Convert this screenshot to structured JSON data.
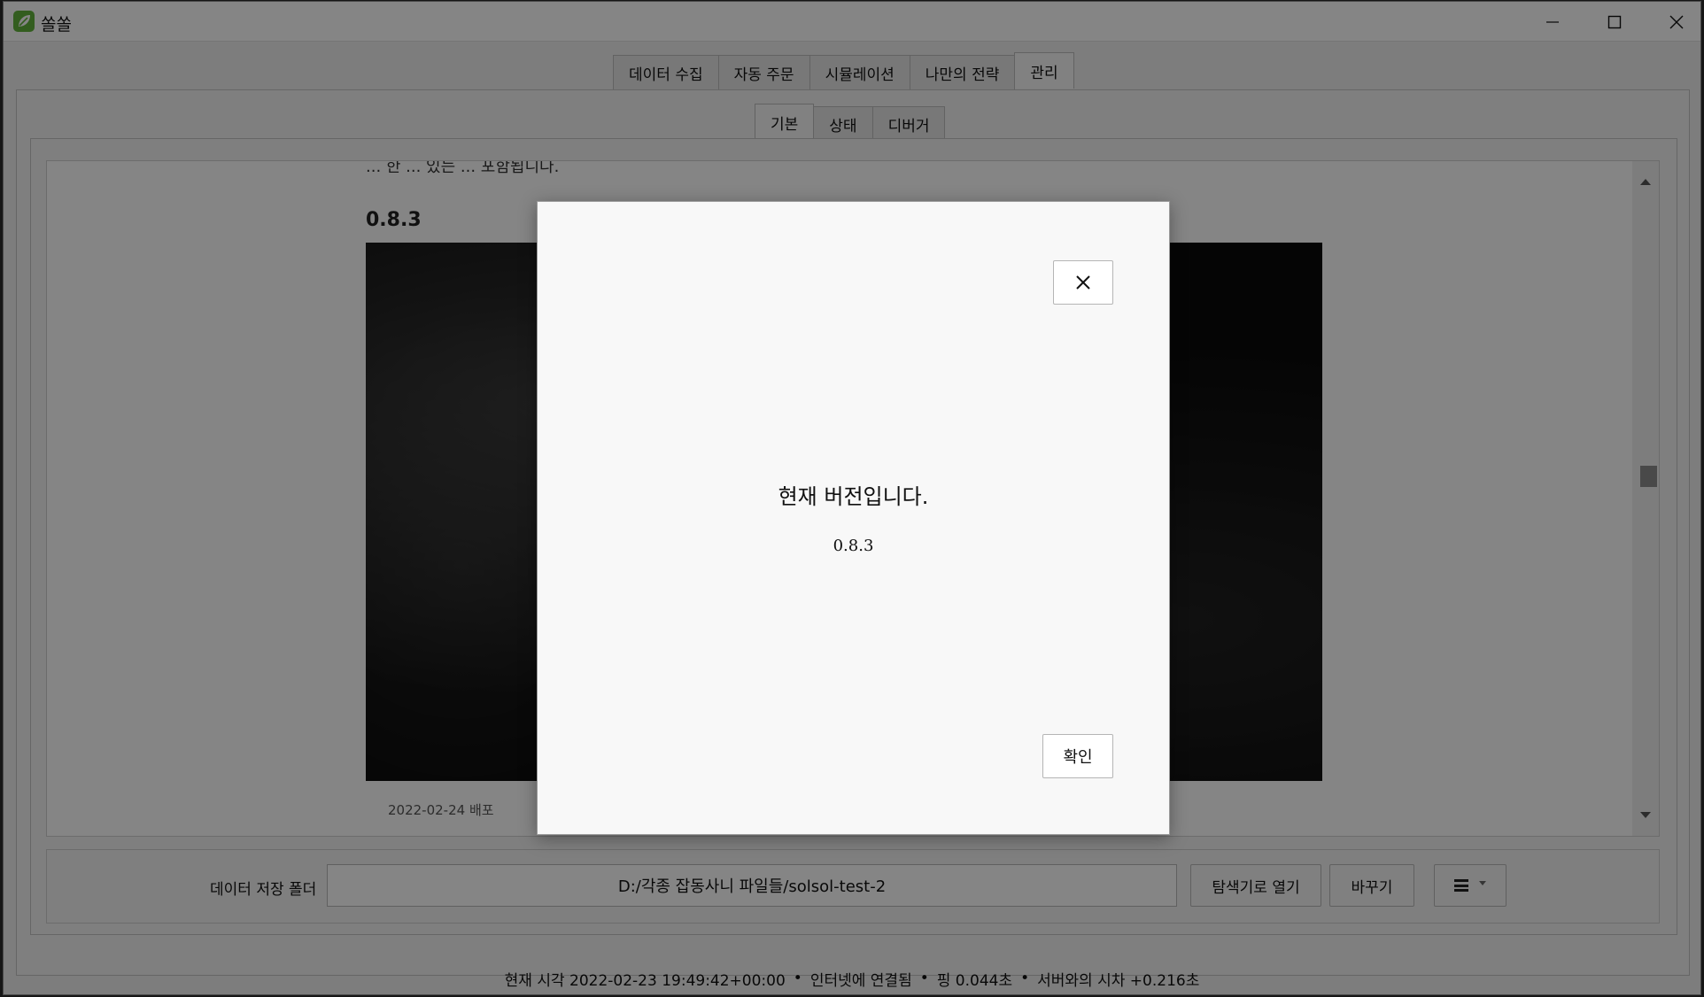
{
  "window": {
    "title": "쏠쏠"
  },
  "top_tabs": [
    {
      "label": "데이터 수집"
    },
    {
      "label": "자동 주문"
    },
    {
      "label": "시뮬레이션"
    },
    {
      "label": "나만의 전략"
    },
    {
      "label": "관리"
    }
  ],
  "top_tabs_active": "관리",
  "sub_tabs": [
    {
      "label": "기본"
    },
    {
      "label": "상태"
    },
    {
      "label": "디버거"
    }
  ],
  "sub_tabs_active": "기본",
  "content": {
    "cut_text": "... 한 ... 있는 ... 포함됩니다.",
    "version_heading": "0.8.3",
    "release_note": "2022-02-24 배포"
  },
  "folder": {
    "label": "데이터 저장 폴더",
    "path": "D:/각종 잡동사니 파일들/solsol-test-2",
    "explorer_button": "탐색기로 열기",
    "change_button": "바꾸기"
  },
  "status": {
    "time": "현재 시각 2022-02-23 19:49:42+00:00",
    "internet": "인터넷에 연결됨",
    "ping": "핑 0.044초",
    "offset": "서버와의 시차 +0.216초",
    "separator": "•"
  },
  "dialog": {
    "title": "현재 버전입니다.",
    "version": "0.8.3",
    "ok_button": "확인"
  },
  "icons": {
    "app": "leaf-logo-icon",
    "close": "close-icon",
    "menu": "hamburger-menu-icon"
  },
  "colors": {
    "app_icon": "#63b33c",
    "overlay": "#000000"
  }
}
